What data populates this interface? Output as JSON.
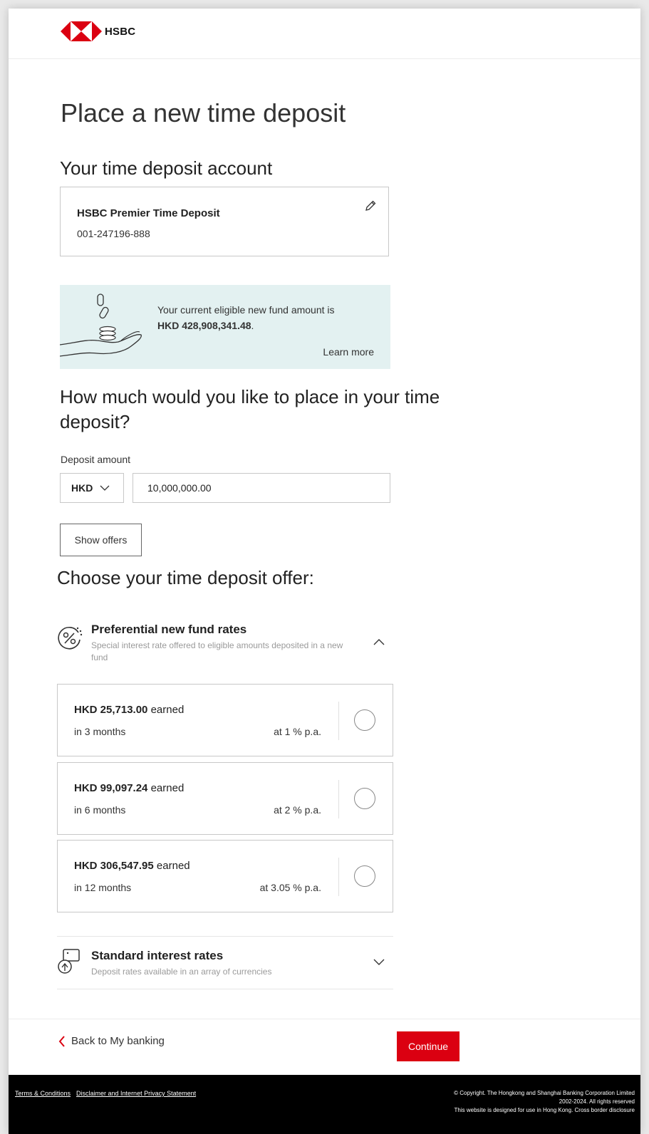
{
  "brand": {
    "name": "HSBC",
    "color": "#db0011",
    "logo_icon": "hsbc-hexagon-logo"
  },
  "page": {
    "title": "Place a new time deposit"
  },
  "account_section": {
    "title": "Your time deposit account",
    "account_name": "HSBC Premier Time Deposit",
    "account_number": "001-247196-888",
    "edit_icon": "pencil-icon"
  },
  "fund_banner": {
    "text_before": "Your current eligible new fund amount is",
    "amount": "HKD 428,908,341.48",
    "text_after": ".",
    "learn_more": "Learn more",
    "background": "#e3f1f1",
    "illustration": "hand-with-coins-illustration"
  },
  "deposit": {
    "question": "How much would you like to place in your time deposit?",
    "label": "Deposit amount",
    "currency": "HKD",
    "amount": "10,000,000.00",
    "show_offers": "Show offers"
  },
  "offers": {
    "title": "Choose your time deposit offer:",
    "preferential": {
      "title": "Preferential new fund rates",
      "description": "Special interest rate offered to eligible amounts deposited in a new fund",
      "expanded": true,
      "icon": "percent-badge-icon",
      "items": [
        {
          "amount": "HKD 25,713.00",
          "earned_label": "earned",
          "period": "in 3 months",
          "rate": "at 1 % p.a.",
          "selected": false
        },
        {
          "amount": "HKD 99,097.24",
          "earned_label": "earned",
          "period": "in 6 months",
          "rate": "at 2 % p.a.",
          "selected": false
        },
        {
          "amount": "HKD 306,547.95",
          "earned_label": "earned",
          "period": "in 12 months",
          "rate": "at 3.05 % p.a.",
          "selected": false
        }
      ]
    },
    "standard": {
      "title": "Standard interest rates",
      "description": "Deposit rates available in an array of currencies",
      "expanded": false,
      "icon": "currency-exchange-icon"
    }
  },
  "actions": {
    "back": "Back to My banking",
    "continue": "Continue"
  },
  "footer": {
    "links": [
      "Terms & Conditions",
      "Disclaimer and Internet Privacy Statement"
    ],
    "copyright_line1": "© Copyright. The Hongkong and Shanghai Banking Corporation Limited",
    "copyright_line2": "2002-2024. All rights reserved",
    "copyright_line3": "This website is designed for use in Hong Kong. Cross border disclosure"
  }
}
